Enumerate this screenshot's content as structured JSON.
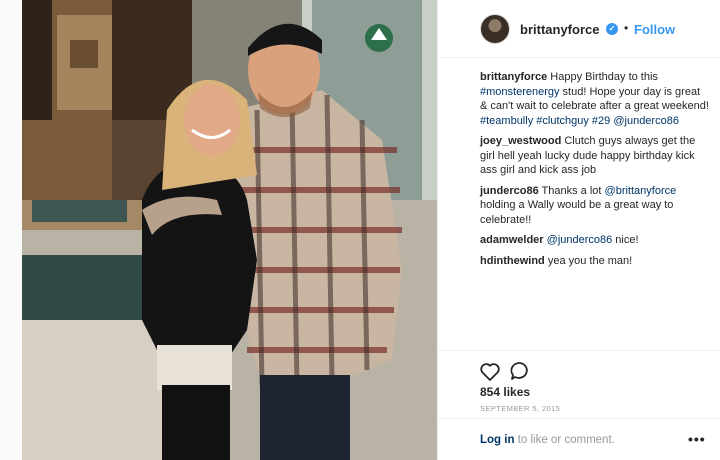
{
  "post": {
    "username": "brittanyforce",
    "verified_badge": "✓",
    "separator": "•",
    "follow_label": "Follow",
    "likes": "854 likes",
    "date": "SEPTEMBER 5, 2015"
  },
  "caption": {
    "user": "brittanyforce",
    "text_1": " Happy Birthday to this ",
    "tag_1": "#monsterenergy",
    "text_2": " stud! Hope your day is great & can't wait to celebrate after a great weekend! ",
    "tag_2": "#teambully",
    "tag_3": "#clutchguy",
    "tag_4": "#29",
    "mention": "@junderco86"
  },
  "comments": [
    {
      "user": "joey_westwood",
      "text": " Clutch guys always get the girl hell yeah lucky dude happy birthday kick ass girl and kick ass job"
    },
    {
      "user": "junderco86",
      "pre": " Thanks a lot ",
      "mention": "@brittanyforce",
      "post": " holding a Wally would be a great way to celebrate!!"
    },
    {
      "user": "adamwelder",
      "mention": " @junderco86",
      "post": " nice!"
    },
    {
      "user": "hdinthewind",
      "text": " yea you the man!"
    }
  ],
  "footer": {
    "login_link": "Log in",
    "login_text": " to like or comment.",
    "more_label": "•••"
  },
  "icons": {
    "like": "heart-icon",
    "comment": "speech-bubble-icon",
    "avatar": "profile-avatar",
    "more": "more-options-icon"
  },
  "colors": {
    "link_blue": "#3897f0",
    "hashtag_navy": "#003569",
    "text": "#262626",
    "muted": "#999999"
  }
}
